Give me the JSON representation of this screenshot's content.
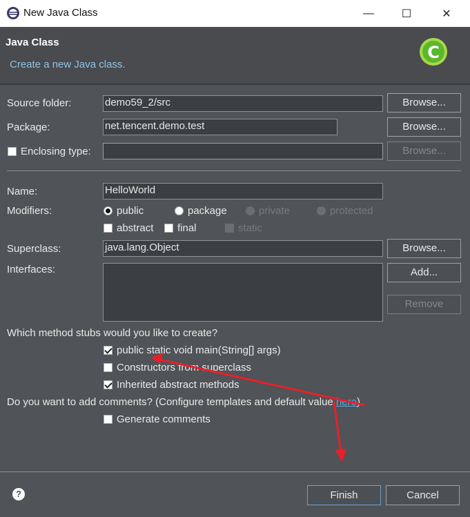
{
  "window": {
    "title": "New Java Class",
    "minimize": "—",
    "maximize": "☐",
    "close": "✕"
  },
  "header": {
    "title": "Java Class",
    "subtitle": "Create a new Java class.",
    "logo_icon": "java-class-c-icon"
  },
  "source_folder": {
    "label": "Source folder:",
    "value": "demo59_2/src",
    "browse": "Browse..."
  },
  "package": {
    "label": "Package:",
    "value": "net.tencent.demo.test",
    "browse": "Browse..."
  },
  "enclosing": {
    "label": "Enclosing type:",
    "checked": false,
    "value": "",
    "browse": "Browse..."
  },
  "name": {
    "label": "Name:",
    "value": "HelloWorld"
  },
  "modifiers": {
    "label": "Modifiers:",
    "public": "public",
    "package": "package",
    "private": "private",
    "protected": "protected",
    "selected": "public",
    "abstract": "abstract",
    "final": "final",
    "static": "static"
  },
  "superclass": {
    "label": "Superclass:",
    "value": "java.lang.Object",
    "browse": "Browse..."
  },
  "interfaces": {
    "label": "Interfaces:",
    "add": "Add...",
    "remove": "Remove"
  },
  "stubs": {
    "question": "Which method stubs would you like to create?",
    "main": {
      "label": "public static void main(String[] args)",
      "checked": true
    },
    "constructors": {
      "label": "Constructors from superclass",
      "checked": false
    },
    "inherited": {
      "label": "Inherited abstract methods",
      "checked": true
    }
  },
  "comments": {
    "question": "Do you want to add comments? (Configure templates and default value ",
    "link": "here",
    "close_paren": ")",
    "generate": {
      "label": "Generate comments",
      "checked": false
    }
  },
  "footer": {
    "help_icon": "help-icon",
    "finish": "Finish",
    "cancel": "Cancel"
  },
  "annotation_color": "#e8202a"
}
